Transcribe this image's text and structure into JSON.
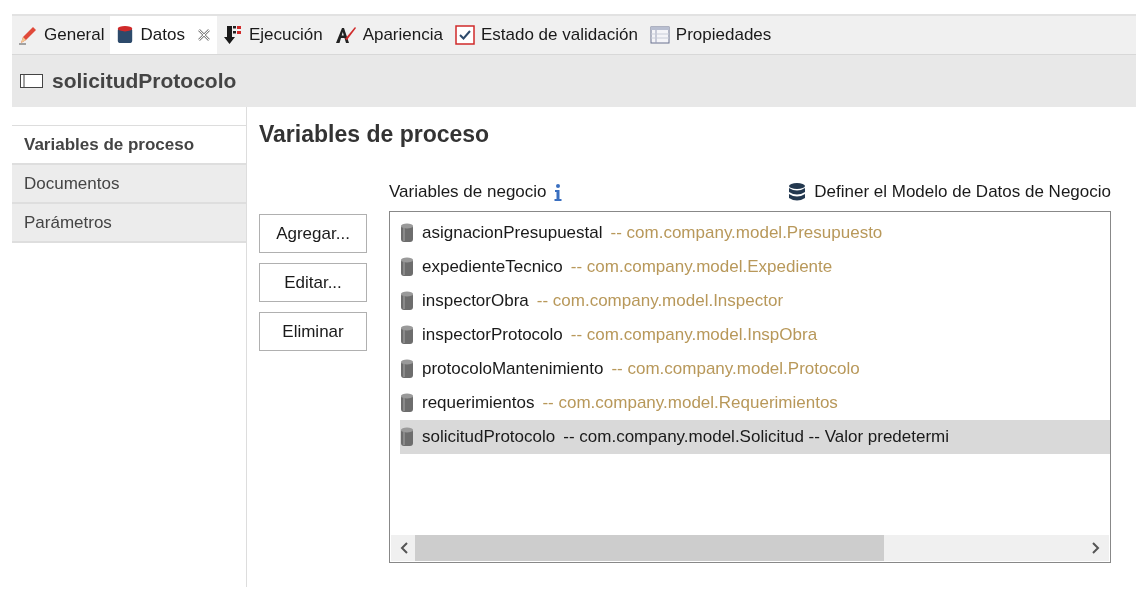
{
  "tabs": [
    {
      "label": "General",
      "kind": "pencil",
      "selected": false
    },
    {
      "label": "Datos",
      "kind": "database",
      "selected": true
    },
    {
      "label": "Ejecución",
      "kind": "flow",
      "selected": false
    },
    {
      "label": "Apariencia",
      "kind": "style",
      "selected": false
    },
    {
      "label": "Estado de validación",
      "kind": "check",
      "selected": false
    },
    {
      "label": "Propiedades",
      "kind": "table",
      "selected": false
    }
  ],
  "header": {
    "title": "solicitudProtocolo"
  },
  "sidebar": {
    "items": [
      {
        "label": "Variables de proceso",
        "selected": true
      },
      {
        "label": "Documentos",
        "selected": false
      },
      {
        "label": "Parámetros",
        "selected": false
      }
    ]
  },
  "section_title": "Variables de proceso",
  "list_label": "Variables de negocio",
  "define_link": "Definer el Modelo de Datos de Negocio",
  "buttons": [
    "Agregar...",
    "Editar...",
    "Eliminar"
  ],
  "variables": [
    {
      "name": "asignacionPresupuestal",
      "detail": "-- com.company.model.Presupuesto",
      "selected": false
    },
    {
      "name": "expedienteTecnico",
      "detail": "-- com.company.model.Expediente",
      "selected": false
    },
    {
      "name": "inspectorObra",
      "detail": "-- com.company.model.Inspector",
      "selected": false
    },
    {
      "name": "inspectorProtocolo",
      "detail": "-- com.company.model.InspObra",
      "selected": false
    },
    {
      "name": "protocoloMantenimiento",
      "detail": "-- com.company.model.Protocolo",
      "selected": false
    },
    {
      "name": "requerimientos",
      "detail": "-- com.company.model.Requerimientos",
      "selected": false
    },
    {
      "name": "solicitudProtocolo",
      "detail": "-- com.company.model.Solicitud -- Valor predetermi",
      "selected": true
    }
  ]
}
